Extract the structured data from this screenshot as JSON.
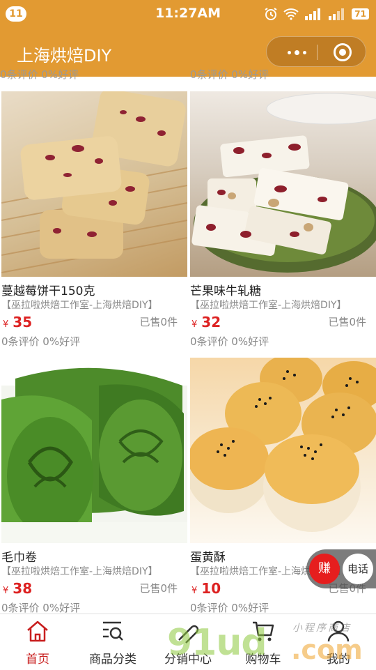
{
  "status_bar": {
    "notification_count": "11",
    "time": "11:27AM",
    "battery": "71",
    "icons": [
      "alarm-icon",
      "wifi-icon",
      "signal-icon",
      "signal-icon"
    ]
  },
  "navbar": {
    "title": "上海烘焙DIY",
    "capsule": [
      "more-dots-icon",
      "close-circle-icon"
    ],
    "color": "#e29a32"
  },
  "peek_row": {
    "left": "0条评价 0%好评",
    "right": "0条评价 0%好评"
  },
  "products": [
    {
      "name": "蔓越莓饼干150克",
      "shop": "【巫拉啦烘焙工作室-上海烘焙DIY】",
      "currency": "¥",
      "price": "35",
      "sold": "已售0件",
      "reviews": "0条评价 0%好评",
      "image": "cranberry-cookie-photo"
    },
    {
      "name": "芒果味牛轧糖",
      "shop": "【巫拉啦烘焙工作室-上海烘焙DIY】",
      "currency": "¥",
      "price": "32",
      "sold": "已售0件",
      "reviews": "0条评价 0%好评",
      "image": "nougat-photo"
    },
    {
      "name": "毛巾卷",
      "shop": "【巫拉啦烘焙工作室-上海烘焙DIY】",
      "currency": "¥",
      "price": "38",
      "sold": "已售0件",
      "reviews": "0条评价 0%好评",
      "image": "matcha-towel-roll-photo"
    },
    {
      "name": "蛋黄酥",
      "shop": "【巫拉啦烘焙工作室-上海烘焙DIY】",
      "currency": "¥",
      "price": "10",
      "sold": "已售0件",
      "reviews": "0条评价 0%好评",
      "image": "egg-yolk-pastry-photo"
    }
  ],
  "float_buttons": {
    "earn": "赚",
    "call": "电话"
  },
  "tabbar": {
    "items": [
      {
        "label": "首页",
        "icon": "home-icon",
        "active": true
      },
      {
        "label": "商品分类",
        "icon": "category-search-icon",
        "active": false
      },
      {
        "label": "分销中心",
        "icon": "distribution-icon",
        "active": false
      },
      {
        "label": "购物车",
        "icon": "cart-icon",
        "active": false
      },
      {
        "label": "我的",
        "icon": "user-icon",
        "active": false
      }
    ],
    "active_color": "#c81e1e"
  },
  "watermark": {
    "main": "91ud",
    "suffix": ".com",
    "tagline": "小程序商店"
  }
}
